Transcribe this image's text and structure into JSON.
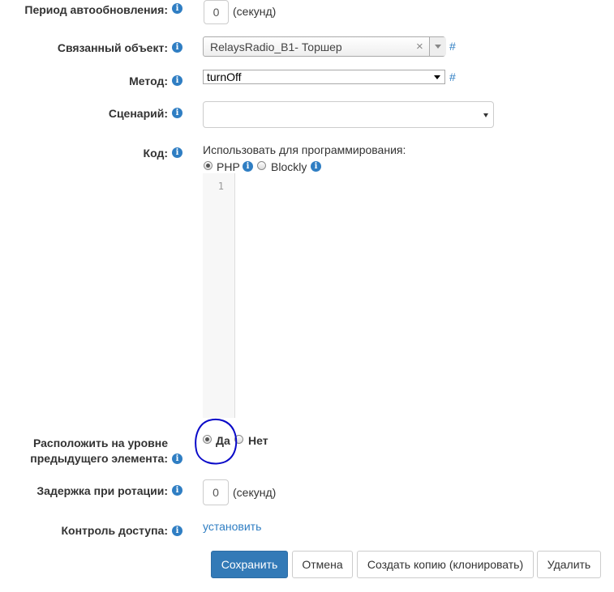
{
  "refresh": {
    "label": "Период автообновления:",
    "value": "0",
    "unit": "(секунд)"
  },
  "linked_object": {
    "label": "Связанный объект:",
    "value": "RelaysRadio_B1- Торшер",
    "hash": "#"
  },
  "method": {
    "label": "Метод:",
    "value": "turnOff",
    "hash": "#"
  },
  "scenario": {
    "label": "Сценарий:",
    "value": ""
  },
  "code": {
    "label": "Код:",
    "use_for_programming": "Использовать для программирования:",
    "options": [
      {
        "label": "PHP",
        "checked": true
      },
      {
        "label": "Blockly",
        "checked": false
      }
    ],
    "line_numbers": [
      "1"
    ]
  },
  "position": {
    "label_line1": "Расположить на уровне",
    "label_line2": "предыдущего элемента:",
    "options": [
      {
        "label": "Да",
        "checked": true
      },
      {
        "label": "Нет",
        "checked": false
      }
    ]
  },
  "rotation_delay": {
    "label": "Задержка при ротации:",
    "value": "0",
    "unit": "(секунд)"
  },
  "access_control": {
    "label": "Контроль доступа:",
    "link": "установить"
  },
  "buttons": {
    "save": "Сохранить",
    "cancel": "Отмена",
    "clone": "Создать копию (клонировать)",
    "delete": "Удалить"
  },
  "icons": {
    "info": "i",
    "clear": "×"
  },
  "colors": {
    "accent": "#337ab7",
    "info_icon": "#2f7ec3",
    "annotation_circle": "#0a0ac8"
  }
}
